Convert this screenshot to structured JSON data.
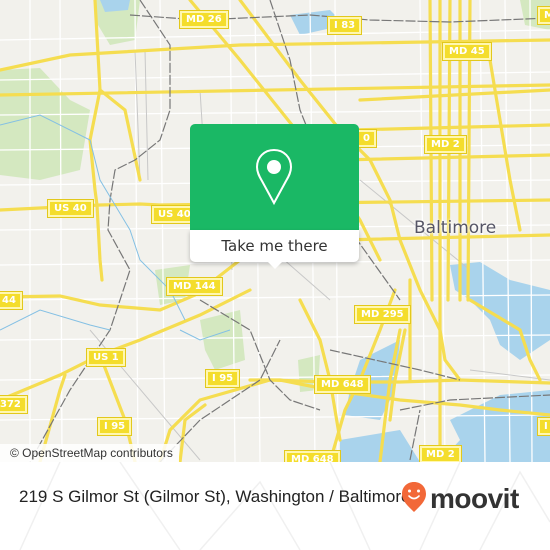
{
  "map": {
    "city_label": "Baltimore",
    "attribution": "© OpenStreetMap contributors",
    "route_shields": [
      {
        "label": "MD 26",
        "id": "md-26"
      },
      {
        "label": "I 83",
        "id": "i-83"
      },
      {
        "label": "MD 45",
        "id": "md-45"
      },
      {
        "label": "M",
        "id": "md-partial-top-right"
      },
      {
        "label": "MD 2",
        "id": "md-2-north"
      },
      {
        "label": "US 40",
        "id": "us-40-west"
      },
      {
        "label": "US 40",
        "id": "us-40-east"
      },
      {
        "label": "0",
        "id": "partial-behind-popup"
      },
      {
        "label": "MD 144",
        "id": "md-144"
      },
      {
        "label": "44",
        "id": "partial-left-44"
      },
      {
        "label": "US 1",
        "id": "us-1"
      },
      {
        "label": "I 95",
        "id": "i-95-center"
      },
      {
        "label": "372",
        "id": "partial-left-372"
      },
      {
        "label": "I 95",
        "id": "i-95-southwest"
      },
      {
        "label": "MD 295",
        "id": "md-295"
      },
      {
        "label": "MD 648",
        "id": "md-648-north"
      },
      {
        "label": "MD 648",
        "id": "md-648-south"
      },
      {
        "label": "MD 2",
        "id": "md-2-south"
      },
      {
        "label": "I",
        "id": "partial-right-i"
      }
    ],
    "colors": {
      "land": "#f2f1ec",
      "park": "#d4e8c0",
      "water": "#a9d3ec",
      "road_major": "#f5dd50",
      "road_minor": "#ffffff",
      "rail": "#777777"
    }
  },
  "popup": {
    "icon": "map-pin-icon",
    "button_label": "Take me there",
    "color": "#1ab865"
  },
  "footer": {
    "address": "219 S Gilmor St (Gilmor St), Washington / Baltimore",
    "logo_text": "moovit",
    "logo_icon": "moovit-smiley-pin-icon",
    "logo_color": "#f26838"
  }
}
